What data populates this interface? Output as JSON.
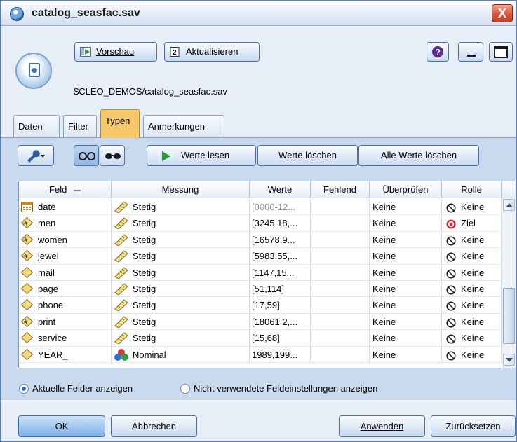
{
  "window": {
    "title": "catalog_seasfac.sav",
    "close_glyph": "X"
  },
  "header": {
    "preview_label": "Vorschau",
    "refresh_label": "Aktualisieren",
    "path": "$CLEO_DEMOS/catalog_seasfac.sav"
  },
  "tabs": [
    {
      "label": "Daten",
      "active": false
    },
    {
      "label": "Filter",
      "active": false
    },
    {
      "label": "Typen",
      "active": true
    },
    {
      "label": "Anmerkungen",
      "active": false
    }
  ],
  "toolbar": {
    "read_values_label": "Werte lesen",
    "clear_values_label": "Werte löschen",
    "clear_all_values_label": "Alle Werte löschen"
  },
  "table": {
    "columns": [
      "Feld",
      "Messung",
      "Werte",
      "Fehlend",
      "Überprüfen",
      "Rolle"
    ],
    "rows": [
      {
        "feld": "date",
        "feld_icon": "calendar-icon",
        "messung": "Stetig",
        "messung_icon": "ruler-icon",
        "werte": "[0000-12...",
        "werte_muted": true,
        "fehlend": "",
        "ueberpruefen": "Keine",
        "rolle": "Keine",
        "rolle_icon": "none-icon"
      },
      {
        "feld": "men",
        "feld_icon": "numeric-field-icon",
        "messung": "Stetig",
        "messung_icon": "ruler-icon",
        "werte": "[3245.18,...",
        "werte_muted": false,
        "fehlend": "",
        "ueberpruefen": "Keine",
        "rolle": "Ziel",
        "rolle_icon": "target-icon"
      },
      {
        "feld": "women",
        "feld_icon": "numeric-field-icon",
        "messung": "Stetig",
        "messung_icon": "ruler-icon",
        "werte": "[16578.9...",
        "werte_muted": false,
        "fehlend": "",
        "ueberpruefen": "Keine",
        "rolle": "Keine",
        "rolle_icon": "none-icon"
      },
      {
        "feld": "jewel",
        "feld_icon": "numeric-field-icon",
        "messung": "Stetig",
        "messung_icon": "ruler-icon",
        "werte": "[5983.55,...",
        "werte_muted": false,
        "fehlend": "",
        "ueberpruefen": "Keine",
        "rolle": "Keine",
        "rolle_icon": "none-icon"
      },
      {
        "feld": "mail",
        "feld_icon": "field-icon",
        "messung": "Stetig",
        "messung_icon": "ruler-icon",
        "werte": "[1147,15...",
        "werte_muted": false,
        "fehlend": "",
        "ueberpruefen": "Keine",
        "rolle": "Keine",
        "rolle_icon": "none-icon"
      },
      {
        "feld": "page",
        "feld_icon": "field-icon",
        "messung": "Stetig",
        "messung_icon": "ruler-icon",
        "werte": "[51,114]",
        "werte_muted": false,
        "fehlend": "",
        "ueberpruefen": "Keine",
        "rolle": "Keine",
        "rolle_icon": "none-icon"
      },
      {
        "feld": "phone",
        "feld_icon": "field-icon",
        "messung": "Stetig",
        "messung_icon": "ruler-icon",
        "werte": "[17,59]",
        "werte_muted": false,
        "fehlend": "",
        "ueberpruefen": "Keine",
        "rolle": "Keine",
        "rolle_icon": "none-icon"
      },
      {
        "feld": "print",
        "feld_icon": "numeric-field-icon",
        "messung": "Stetig",
        "messung_icon": "ruler-icon",
        "werte": "[18061.2,...",
        "werte_muted": false,
        "fehlend": "",
        "ueberpruefen": "Keine",
        "rolle": "Keine",
        "rolle_icon": "none-icon"
      },
      {
        "feld": "service",
        "feld_icon": "field-icon",
        "messung": "Stetig",
        "messung_icon": "ruler-icon",
        "werte": "[15,68]",
        "werte_muted": false,
        "fehlend": "",
        "ueberpruefen": "Keine",
        "rolle": "Keine",
        "rolle_icon": "none-icon"
      },
      {
        "feld": "YEAR_",
        "feld_icon": "field-icon",
        "messung": "Nominal",
        "messung_icon": "nominal-icon",
        "werte": "1989,199...",
        "werte_muted": false,
        "fehlend": "",
        "ueberpruefen": "Keine",
        "rolle": "Keine",
        "rolle_icon": "none-icon"
      }
    ]
  },
  "options": {
    "current_fields_label": "Aktuelle Felder anzeigen",
    "unused_settings_label": "Nicht verwendete Feldeinstellungen anzeigen",
    "selected": "current_fields"
  },
  "footer": {
    "ok_label": "OK",
    "cancel_label": "Abbrechen",
    "apply_label": "Anwenden",
    "reset_label": "Zurücksetzen"
  },
  "colors": {
    "accent": "#2b6bd6",
    "active_tab": "#f6c86b",
    "target_red": "#d81e1e",
    "play_green": "#1e9e2a"
  }
}
